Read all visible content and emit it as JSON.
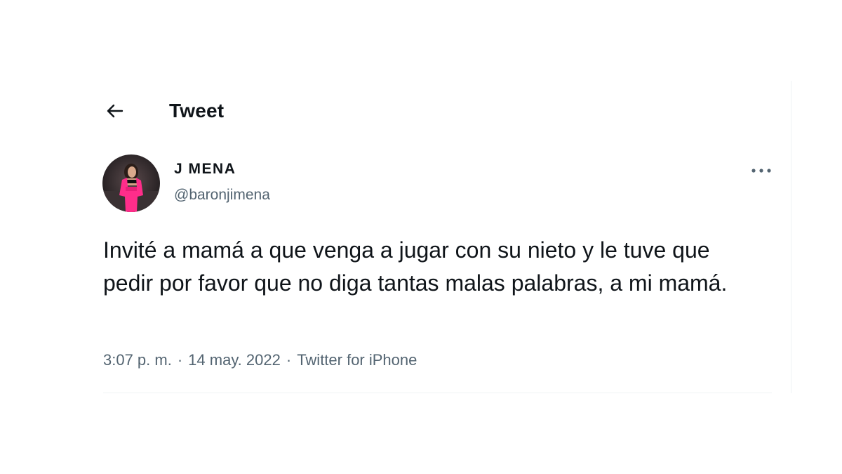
{
  "header": {
    "back_icon": "arrow-left-icon",
    "title": "Tweet"
  },
  "tweet": {
    "author": {
      "display_name": "J MENA",
      "display_name_prefix": "J",
      "display_name_rest": "MENA",
      "handle": "@baronjimena",
      "avatar_icon": "avatar-photo"
    },
    "more_icon": "more-horizontal-icon",
    "text": "Invité a mamá a que venga a jugar con su nieto y le tuve que pedir por favor que no diga tantas malas palabras, a mi mamá.",
    "meta": {
      "time": "3:07 p. m.",
      "separator": "·",
      "date": "14 may. 2022",
      "source": "Twitter for iPhone"
    }
  },
  "colors": {
    "text_primary": "#0f1419",
    "text_secondary": "#536471",
    "divider": "#eff3f4",
    "avatar_accent": "#ff2d8a"
  }
}
